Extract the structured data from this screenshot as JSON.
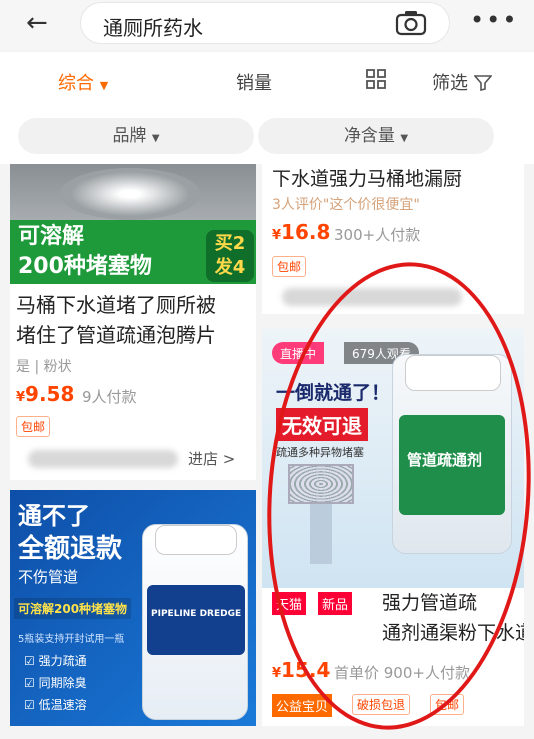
{
  "header": {
    "search_text": "通厕所药水"
  },
  "sortbar": {
    "comprehensive": "综合",
    "sales": "销量",
    "filter": "筛选"
  },
  "chips": {
    "brand": "品牌",
    "net_content": "净含量"
  },
  "products": [
    {
      "banner_text": "可溶解\n200种堵塞物",
      "badge": "买2\n发4",
      "title": "马桶下水道堵了厕所被\n堵住了管道疏通泡腾片",
      "meta": "是 | 粉状",
      "price": "9.58",
      "sold": "9人付款",
      "tag": "包邮",
      "shop_link": "进店 >"
    },
    {
      "title_top": "下水道强力马桶地漏厨",
      "review": "3人评价\"这个价很便宜\"",
      "price": "16.8",
      "sold": "300+人付款",
      "tag": "包邮"
    },
    {
      "live_badge": "直播中",
      "viewers": "679人观看",
      "banner": "一倒就通了！",
      "red_label": "无效可退",
      "sub_label": "疏通多种异物堵塞",
      "bottle_label": "管道疏通剂",
      "tags": [
        "天猫",
        "新品"
      ],
      "title": "强力管道疏\n通剂通渠粉下水道堵塞",
      "price": "15.4",
      "sold": "首单价 900+人付款",
      "promo": [
        "公益宝贝",
        "破损包退",
        "包邮"
      ]
    },
    {
      "banner1": "通不了",
      "banner2": "全额退款",
      "banner3": "不伤管道",
      "banner4": "可溶解200种堵塞物",
      "banner5": "5瓶装支持开封试用一瓶",
      "features": [
        "强力疏通",
        "同期除臭",
        "低温速溶"
      ],
      "product_name": "PIPELINE DREDGE"
    }
  ],
  "colors": {
    "accent": "#ff6a00",
    "price": "#ff4400",
    "annotation": "#e01818"
  }
}
